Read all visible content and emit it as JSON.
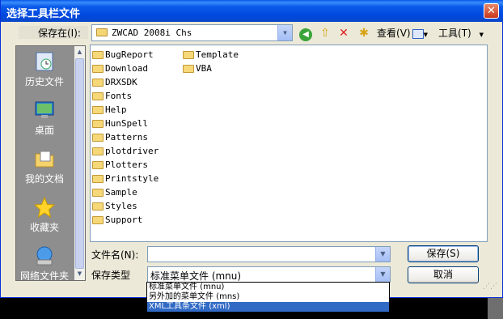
{
  "window": {
    "title": "选择工具栏文件",
    "close_glyph": "✕"
  },
  "save_in": {
    "label": "保存在(I):",
    "value": "ZWCAD 2008i Chs"
  },
  "toolbar": {
    "view_label": "查看(V)",
    "tools_label": "工具(T)"
  },
  "places": [
    {
      "label": "历史文件",
      "icon": "recent-icon"
    },
    {
      "label": "桌面",
      "icon": "desktop-icon"
    },
    {
      "label": "我的文档",
      "icon": "my-documents-icon"
    },
    {
      "label": "收藏夹",
      "icon": "favorites-icon"
    },
    {
      "label": "网络文件夹",
      "icon": "network-icon"
    }
  ],
  "files_col1": [
    "BugReport",
    "Download",
    "DRXSDK",
    "Fonts",
    "Help",
    "HunSpell",
    "Patterns",
    "plotdriver",
    "Plotters",
    "Printstyle",
    "Sample",
    "Styles",
    "Support"
  ],
  "files_col2": [
    "Template",
    "VBA"
  ],
  "filename": {
    "label": "文件名(N):",
    "value": ""
  },
  "filetype": {
    "label": "保存类型",
    "value": "标准菜单文件 (mnu)"
  },
  "buttons": {
    "save": "保存(S)",
    "cancel": "取消"
  },
  "dropdown_options": [
    {
      "label": "标准菜单文件 (mnu)",
      "selected": false
    },
    {
      "label": "另外加的菜单文件 (mns)",
      "selected": false
    },
    {
      "label": "XML工具条文件 (xml)",
      "selected": true
    }
  ],
  "colors": {
    "title_bar": "#0a5be9",
    "selection": "#316ac5",
    "dialog_bg": "#ece9d8"
  }
}
